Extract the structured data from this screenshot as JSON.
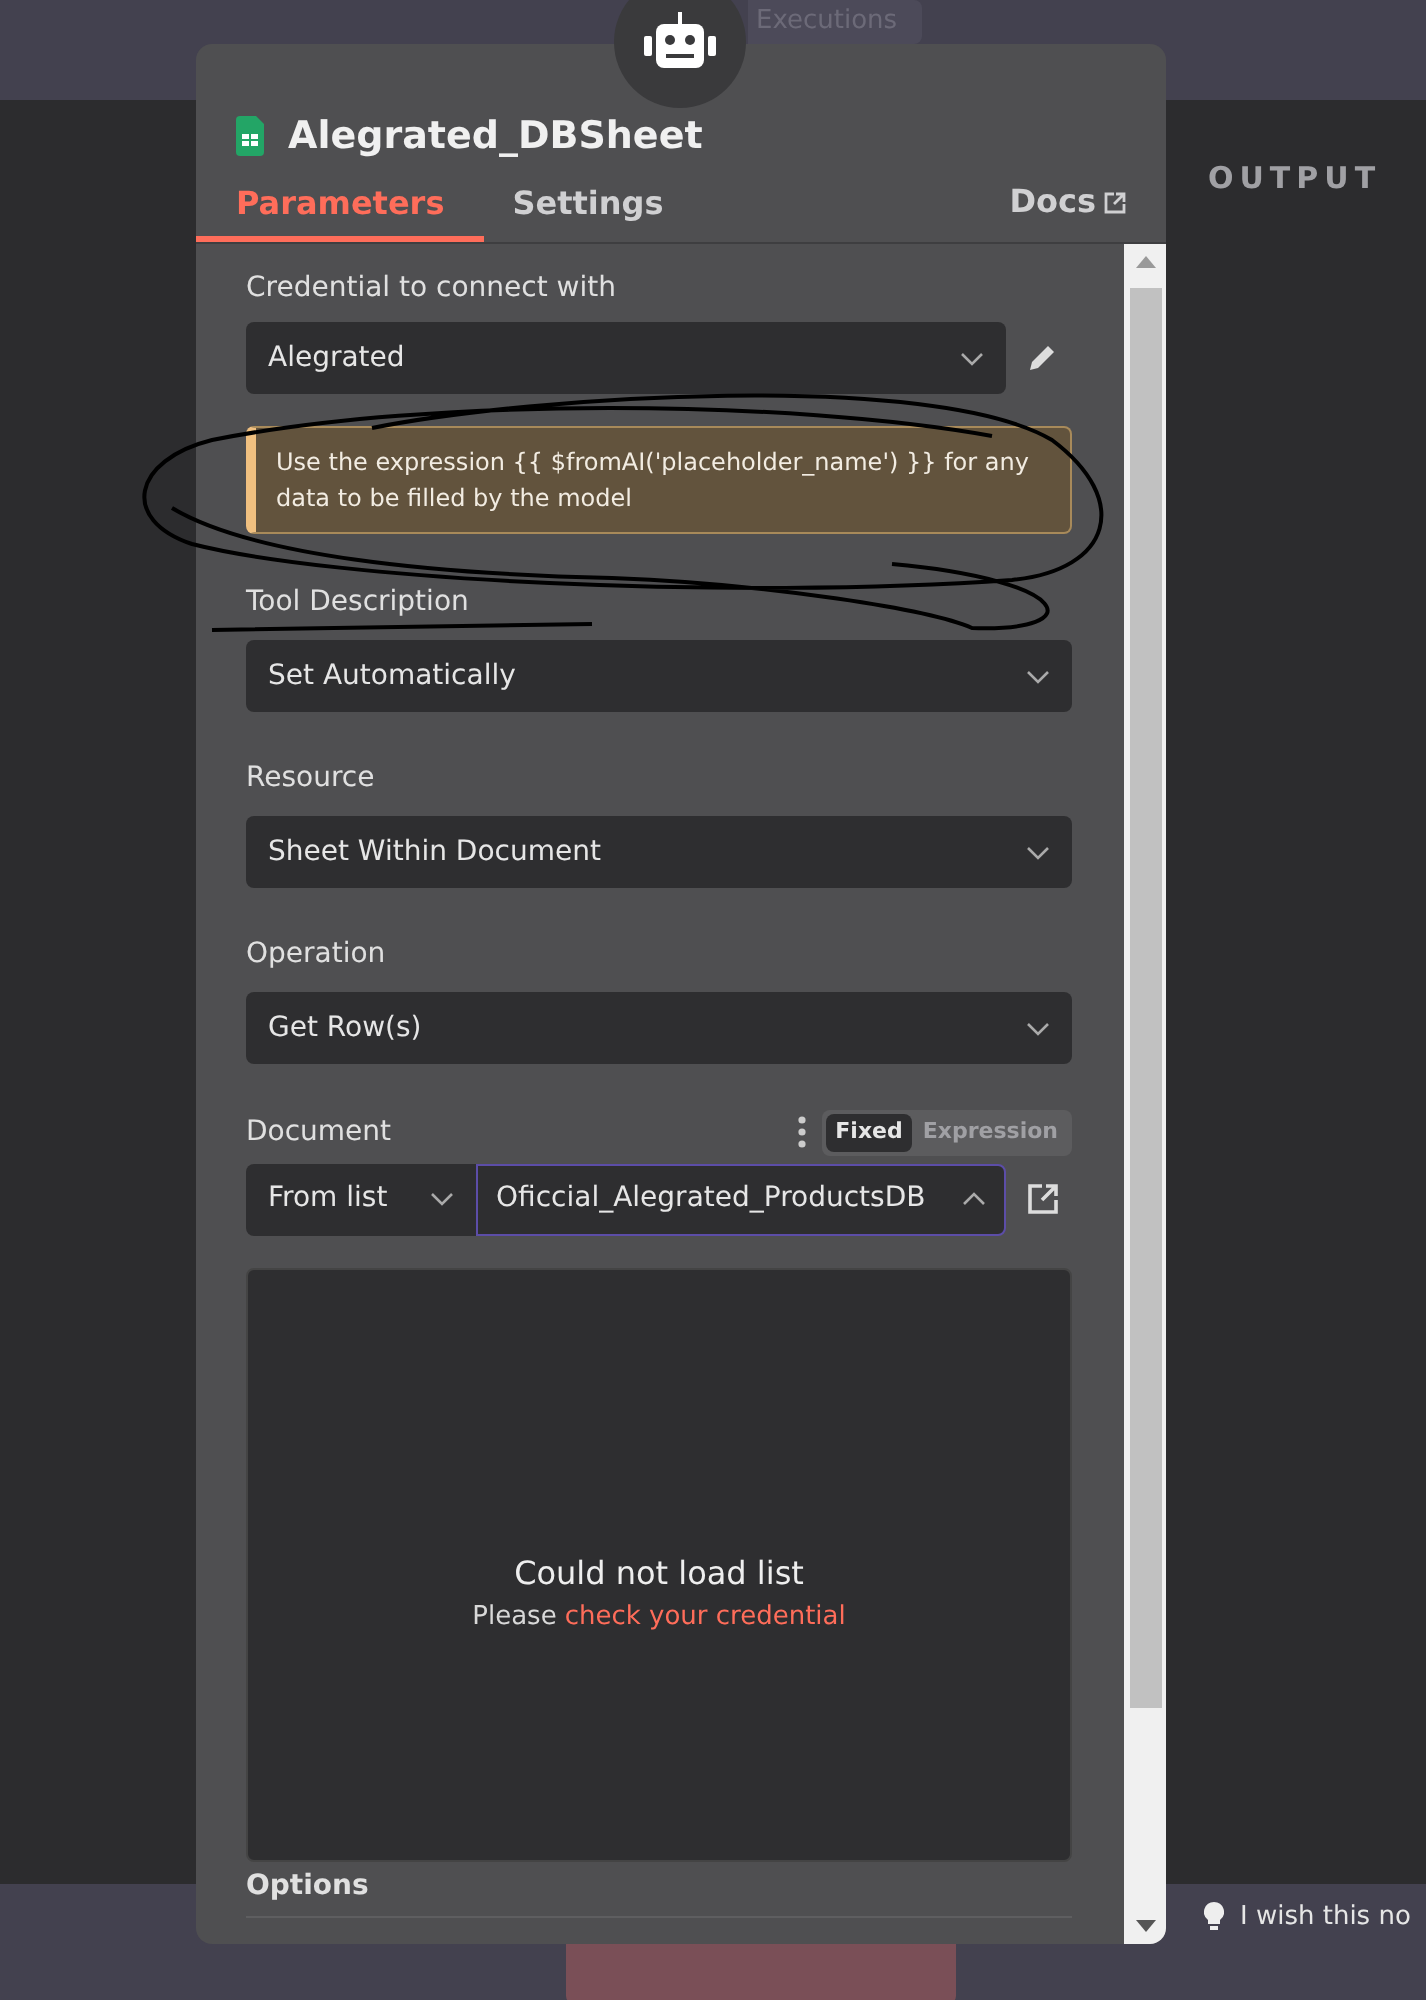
{
  "background": {
    "top_tab": "Executions",
    "output_label": "OUTPUT",
    "feedback": "I wish this no"
  },
  "node": {
    "title": "Alegrated_DBSheet",
    "docs_link": "Docs",
    "tabs": [
      {
        "label": "Parameters",
        "selected": true
      },
      {
        "label": "Settings",
        "selected": false
      }
    ]
  },
  "parameters": [
    {
      "kind": "credential",
      "label": "Credential to connect with",
      "value": "Alegrated"
    },
    {
      "kind": "notice",
      "text": "Use the expression {{ $fromAI('placeholder_name') }} for any data to be filled by the model"
    },
    {
      "kind": "select",
      "label": "Tool Description",
      "value": "Set Automatically"
    },
    {
      "kind": "select",
      "label": "Resource",
      "value": "Sheet Within Document"
    },
    {
      "kind": "select",
      "label": "Operation",
      "value": "Get Row(s)"
    },
    {
      "kind": "resource",
      "label": "Document",
      "modes": [
        {
          "label": "Fixed",
          "selected": true
        },
        {
          "label": "Expression",
          "selected": false
        }
      ],
      "source": "From list",
      "value": "Oficcial_Alegrated_ProductsDB",
      "expanded": true,
      "list": {
        "message": "Could not load list",
        "hint": "Please",
        "hint_link": "check your credential"
      }
    },
    {
      "kind": "section",
      "label": "Options"
    }
  ]
}
